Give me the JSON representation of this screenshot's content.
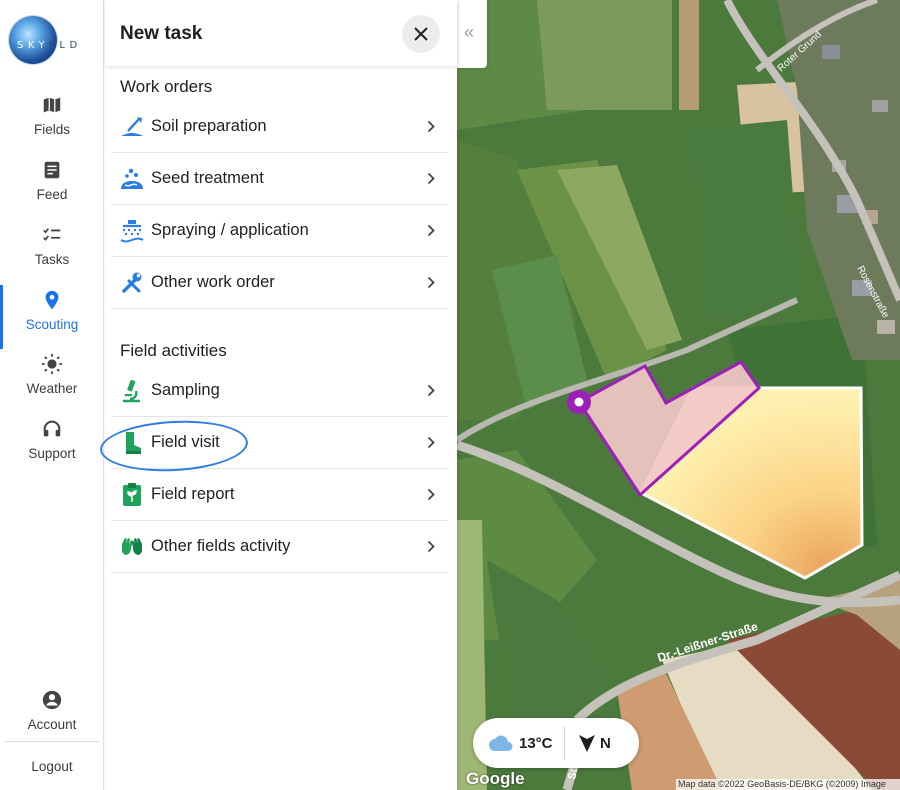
{
  "brand": {
    "letters_light": "SKY",
    "letters_dark": "FLD"
  },
  "nav": {
    "items": [
      {
        "id": "fields",
        "label": "Fields",
        "icon": "map-icon"
      },
      {
        "id": "feed",
        "label": "Feed",
        "icon": "feed-icon"
      },
      {
        "id": "tasks",
        "label": "Tasks",
        "icon": "tasks-icon"
      },
      {
        "id": "scouting",
        "label": "Scouting",
        "icon": "location-pin-icon",
        "active": true
      },
      {
        "id": "weather",
        "label": "Weather",
        "icon": "sun-icon"
      },
      {
        "id": "support",
        "label": "Support",
        "icon": "headset-icon"
      }
    ],
    "account_label": "Account",
    "logout_label": "Logout"
  },
  "panel": {
    "title": "New task",
    "sections": [
      {
        "title": "Work orders",
        "items": [
          {
            "label": "Soil preparation",
            "icon": "soil-preparation-icon"
          },
          {
            "label": "Seed treatment",
            "icon": "seed-treatment-icon"
          },
          {
            "label": "Spraying / application",
            "icon": "spraying-icon"
          },
          {
            "label": "Other work order",
            "icon": "tools-icon"
          }
        ]
      },
      {
        "title": "Field activities",
        "items": [
          {
            "label": "Sampling",
            "icon": "microscope-icon"
          },
          {
            "label": "Field visit",
            "icon": "boot-icon"
          },
          {
            "label": "Field report",
            "icon": "clipboard-plant-icon"
          },
          {
            "label": "Other fields activity",
            "icon": "gloves-icon"
          }
        ]
      }
    ]
  },
  "map": {
    "temperature": "13°C",
    "north": "N",
    "street_labels": [
      "Roter Grund",
      "Rosenstraße",
      "Dr.-Leißner-Straße",
      "Straße"
    ],
    "google": "Google",
    "attribution": "Map data ©2022 GeoBasis-DE/BKG (©2009) Image",
    "colors": {
      "boundary": "#9c1fb8",
      "heat_low": "#ffe9a3",
      "heat_high": "#f3b46a",
      "selected_fill": "#f0c8c8"
    }
  }
}
